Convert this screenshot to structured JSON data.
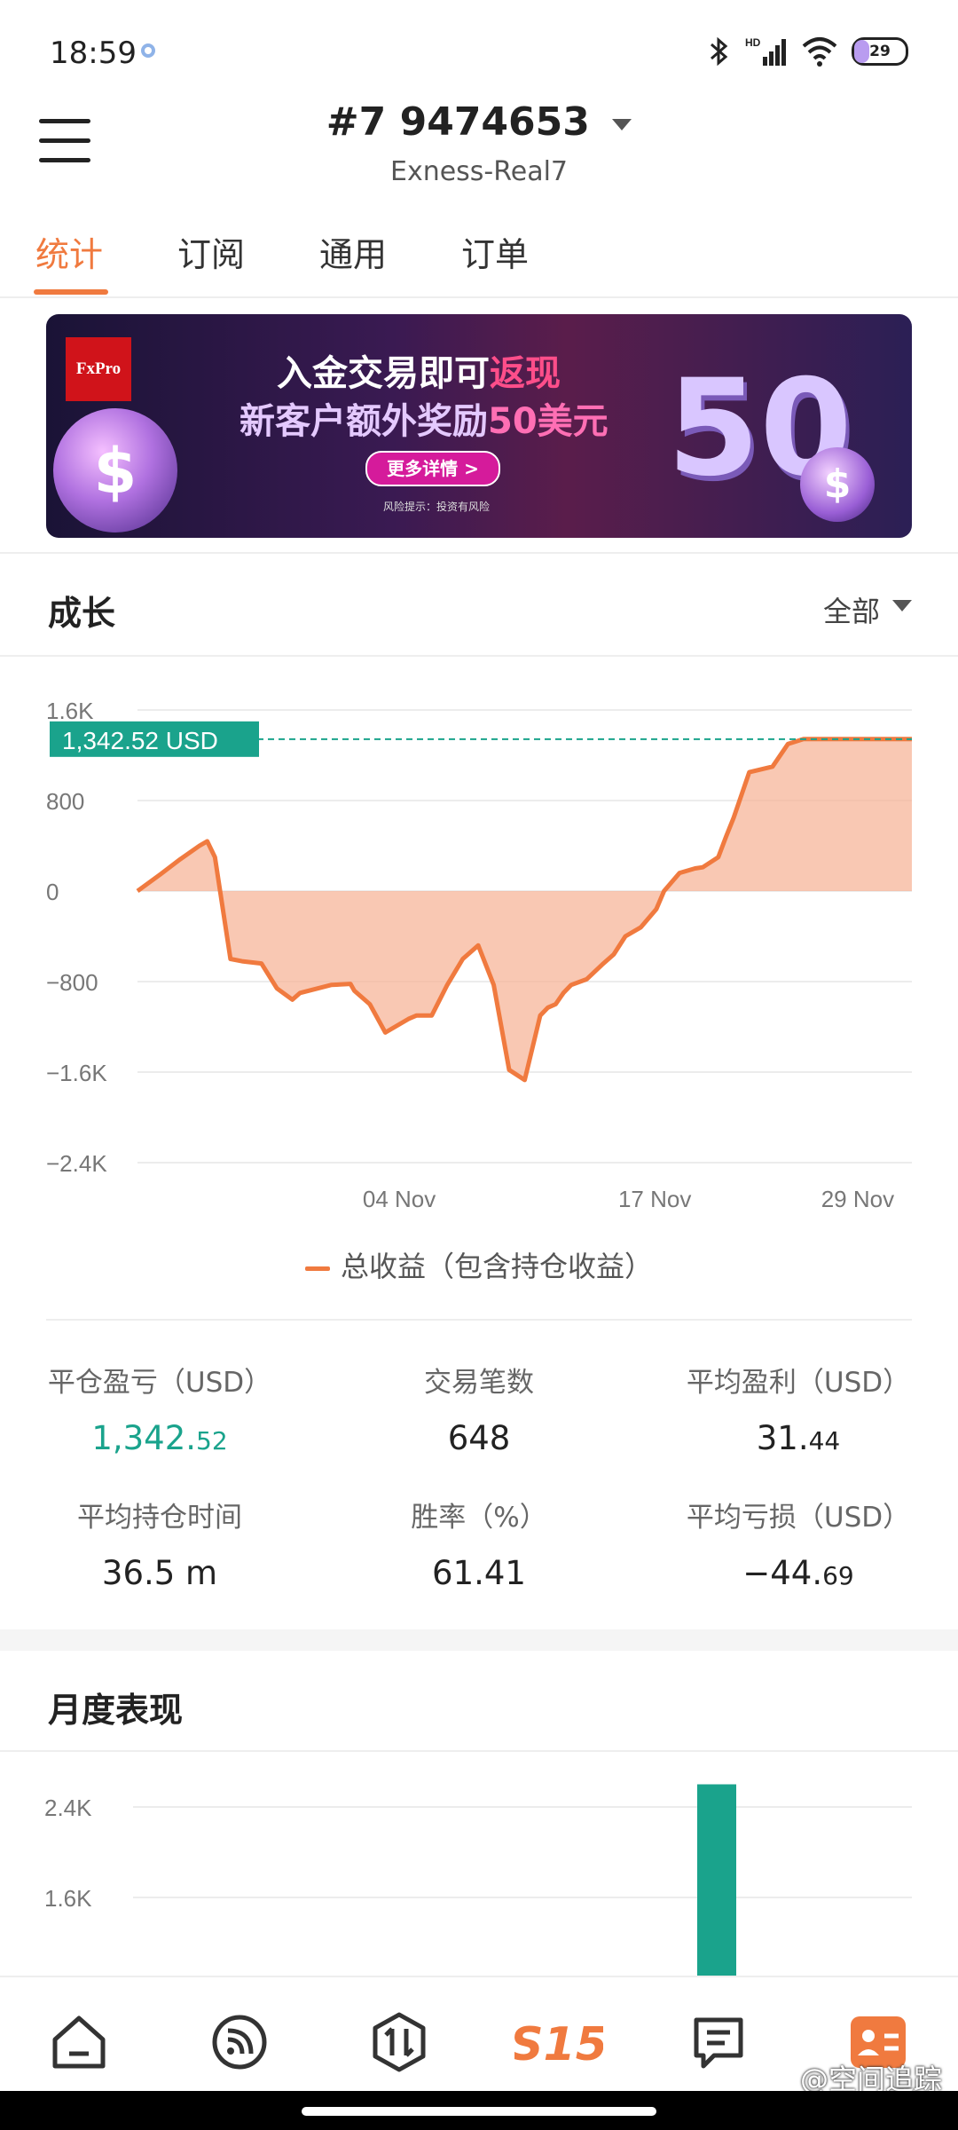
{
  "status_bar": {
    "time": "18:59",
    "battery": "29"
  },
  "header": {
    "account_number": "#7 9474653",
    "server": "Exness-Real7"
  },
  "tabs": [
    {
      "label": "统计",
      "active": true
    },
    {
      "label": "订阅",
      "active": false
    },
    {
      "label": "通用",
      "active": false
    },
    {
      "label": "订单",
      "active": false
    }
  ],
  "banner": {
    "logo": "FxPro",
    "line1_a": "入金交易即可",
    "line1_b": "返现",
    "line2_a": "新客户额外奖励",
    "line2_b": "50美元",
    "button": "更多详情 >",
    "risk": "风险提示：投资有风险",
    "big_number": "50"
  },
  "growth": {
    "title": "成长",
    "filter": "全部",
    "current_label": "1,342.52 USD",
    "legend": "总收益（包含持仓收益）"
  },
  "chart_data": {
    "type": "area",
    "ylabel_ticks": [
      "1.6K",
      "800",
      "0",
      "−800",
      "−1.6K",
      "−2.4K"
    ],
    "y_tick_values": [
      1600,
      800,
      0,
      -800,
      -1600,
      -2400
    ],
    "x_tick_labels": [
      "04 Nov",
      "17 Nov",
      "29 Nov"
    ],
    "x_tick_fraction": [
      0.338,
      0.668,
      0.93
    ],
    "ylim": [
      -2400,
      1600
    ],
    "current_value": 1342.52,
    "series": [
      {
        "name": "总收益（包含持仓收益）",
        "color": "#f07a3f",
        "x": [
          0,
          0.03,
          0.055,
          0.08,
          0.09,
          0.1,
          0.12,
          0.135,
          0.16,
          0.18,
          0.2,
          0.21,
          0.25,
          0.275,
          0.28,
          0.3,
          0.32,
          0.35,
          0.36,
          0.38,
          0.4,
          0.42,
          0.44,
          0.46,
          0.48,
          0.5,
          0.52,
          0.53,
          0.54,
          0.55,
          0.56,
          0.58,
          0.6,
          0.615,
          0.63,
          0.65,
          0.67,
          0.68,
          0.7,
          0.72,
          0.73,
          0.75,
          0.76,
          0.77,
          0.79,
          0.82,
          0.84,
          0.86,
          0.87,
          0.89,
          0.9,
          0.92,
          0.94,
          0.96,
          0.98,
          1.0
        ],
        "y": [
          0,
          150,
          280,
          400,
          440,
          300,
          -600,
          -620,
          -640,
          -860,
          -960,
          -900,
          -830,
          -820,
          -880,
          -1000,
          -1250,
          -1130,
          -1100,
          -1100,
          -830,
          -600,
          -480,
          -830,
          -1580,
          -1670,
          -1100,
          -1030,
          -1000,
          -900,
          -830,
          -780,
          -650,
          -560,
          -400,
          -320,
          -160,
          0,
          160,
          200,
          210,
          300,
          480,
          650,
          1050,
          1100,
          1300,
          1342.52,
          1342.52,
          1342.52,
          1342.52,
          1342.52,
          1342.52,
          1342.52,
          1342.52,
          1342.52
        ]
      }
    ]
  },
  "stats": {
    "close_pl_label": "平仓盈亏（USD）",
    "close_pl_int": "1,342.",
    "close_pl_dec": "52",
    "trades_label": "交易笔数",
    "trades_value": "648",
    "avg_profit_label": "平均盈利（USD）",
    "avg_profit_int": "31.",
    "avg_profit_dec": "44",
    "avg_hold_label": "平均持仓时间",
    "avg_hold_value": "36.5 m",
    "winrate_label": "胜率（%）",
    "winrate_value": "61.41",
    "avg_loss_label": "平均亏损（USD）",
    "avg_loss_int": "−44.",
    "avg_loss_dec": "69"
  },
  "monthly": {
    "title": "月度表现",
    "tick_labels": [
      "2.4K",
      "1.6K"
    ],
    "bar_value_k": 2.6,
    "bar_color": "#1aa38c"
  },
  "bottom_nav": [
    "home-icon",
    "rss-icon",
    "trade-icon",
    "s15-logo-icon",
    "notes-icon",
    "profile-icon"
  ],
  "watermark": "@空间追踪"
}
